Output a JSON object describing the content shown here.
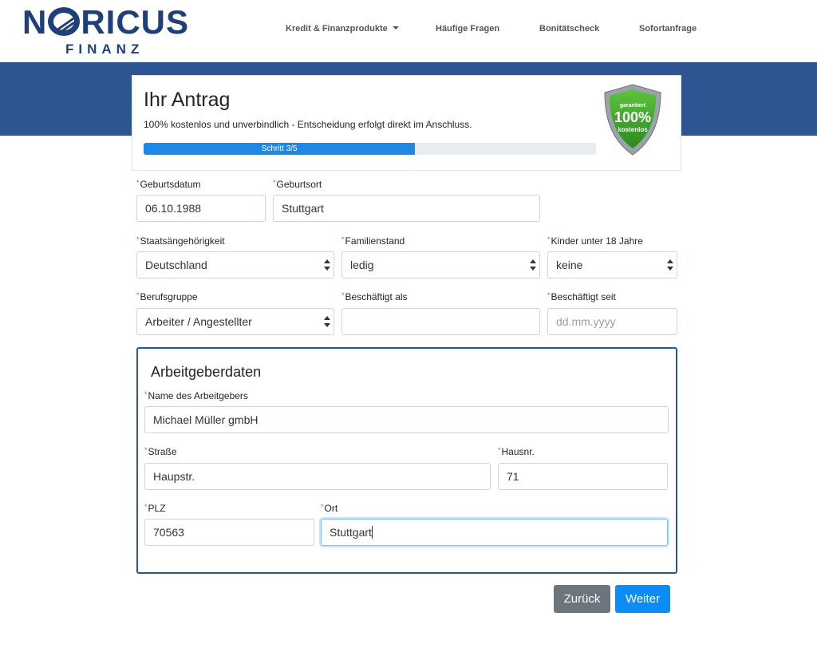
{
  "header": {
    "logo_top_pre": "N",
    "logo_top_post": "RICUS",
    "logo_bottom": "FINANZ",
    "nav": [
      {
        "label": "Kredit & Finanzprodukte",
        "has_dropdown": true
      },
      {
        "label": "Häufige Fragen"
      },
      {
        "label": "Bonitätscheck"
      },
      {
        "label": "Sofortanfrage"
      }
    ]
  },
  "card": {
    "title": "Ihr Antrag",
    "subtitle": "100% kostenlos und unverbindlich - Entscheidung erfolgt direkt im Anschluss.",
    "progress_label": "Schritt 3/5",
    "progress_fraction": 0.6,
    "badge_top": "garantiert",
    "badge_main": "100%",
    "badge_bottom": "kostenlos"
  },
  "required_mark": "*",
  "form": {
    "geburtsdatum": {
      "label": "Geburtsdatum",
      "value": "06.10.1988"
    },
    "geburtsort": {
      "label": "Geburtsort",
      "value": "Stuttgart"
    },
    "staatsangehoerigkeit": {
      "label": "Staatsängehörigkeit",
      "value": "Deutschland"
    },
    "familienstand": {
      "label": "Familienstand",
      "value": "ledig"
    },
    "kinder": {
      "label": "Kinder unter 18 Jahre",
      "value": "keine"
    },
    "berufsgruppe": {
      "label": "Berufsgruppe",
      "value": "Arbeiter / Angestellter"
    },
    "beschaeftigt_als": {
      "label": "Beschäftigt als",
      "value": ""
    },
    "beschaeftigt_seit": {
      "label": "Beschäftigt seit",
      "value": "",
      "placeholder": "dd.mm.yyyy"
    }
  },
  "employer": {
    "legend": "Arbeitgeberdaten",
    "name": {
      "label": "Name des Arbeitgebers",
      "value": "Michael Müller gmbH"
    },
    "strasse": {
      "label": "Straße",
      "value": "Haupstr."
    },
    "hausnr": {
      "label": "Hausnr.",
      "value": "71"
    },
    "plz": {
      "label": "PLZ",
      "value": "70563"
    },
    "ort": {
      "label": "Ort",
      "value": "Stuttgart"
    }
  },
  "buttons": {
    "back": "Zurück",
    "next": "Weiter"
  },
  "colors": {
    "brand_blue": "#2d5592",
    "logo_blue": "#1f3f7a",
    "progress": "#1e88e5",
    "next_button": "#0b8cf7",
    "back_button": "#6c757d",
    "badge_green": "#3aa12b"
  }
}
